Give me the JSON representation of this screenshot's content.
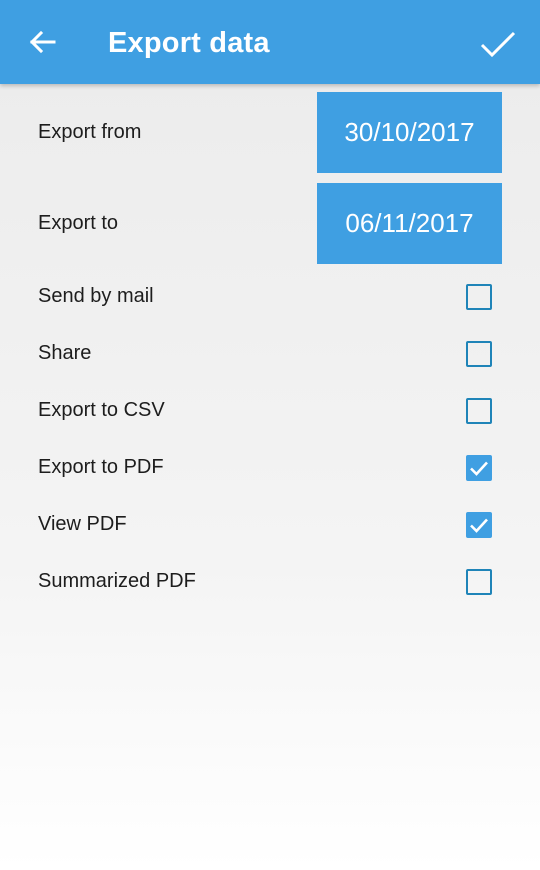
{
  "header": {
    "title": "Export data",
    "back_icon": "arrow-left-icon",
    "confirm_icon": "check-icon",
    "color": "#3f9fe2"
  },
  "export_from": {
    "label": "Export from",
    "date": "30/10/2017"
  },
  "export_to": {
    "label": "Export to",
    "date": "06/11/2017"
  },
  "options": [
    {
      "label": "Send by mail",
      "checked": false
    },
    {
      "label": "Share",
      "checked": false
    },
    {
      "label": "Export to CSV",
      "checked": false
    },
    {
      "label": "Export to PDF",
      "checked": true
    },
    {
      "label": "View PDF",
      "checked": true
    },
    {
      "label": "Summarized PDF",
      "checked": false
    }
  ]
}
